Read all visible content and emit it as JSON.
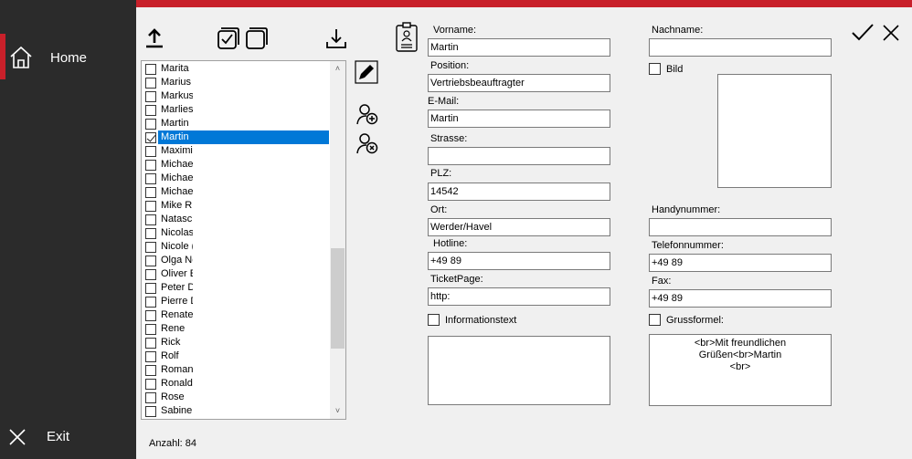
{
  "sidebar": {
    "home_label": "Home",
    "exit_label": "Exit"
  },
  "toolbar_icons": [
    "upload-icon",
    "check-all-icon",
    "uncheck-all-icon",
    "download-icon",
    "contact-card-icon",
    "edit-icon",
    "add-user-icon",
    "remove-user-icon",
    "confirm-icon",
    "close-icon"
  ],
  "list": {
    "items": [
      {
        "label": "Marita",
        "checked": false,
        "selected": false
      },
      {
        "label": "Marius",
        "checked": false,
        "selected": false
      },
      {
        "label": "Markus",
        "checked": false,
        "selected": false
      },
      {
        "label": "Marlies",
        "checked": false,
        "selected": false
      },
      {
        "label": "Martin",
        "checked": false,
        "selected": false
      },
      {
        "label": "Martin",
        "checked": true,
        "selected": true
      },
      {
        "label": "Maximil",
        "checked": false,
        "selected": false
      },
      {
        "label": "Michae",
        "checked": false,
        "selected": false
      },
      {
        "label": "Michae",
        "checked": false,
        "selected": false
      },
      {
        "label": "Michae",
        "checked": false,
        "selected": false
      },
      {
        "label": "Mike R",
        "checked": false,
        "selected": false
      },
      {
        "label": "Natasc",
        "checked": false,
        "selected": false
      },
      {
        "label": "Nicolas",
        "checked": false,
        "selected": false
      },
      {
        "label": "Nicole (",
        "checked": false,
        "selected": false
      },
      {
        "label": "Olga Ne",
        "checked": false,
        "selected": false
      },
      {
        "label": "Oliver E",
        "checked": false,
        "selected": false
      },
      {
        "label": "Peter D",
        "checked": false,
        "selected": false
      },
      {
        "label": "Pierre D",
        "checked": false,
        "selected": false
      },
      {
        "label": "Renate",
        "checked": false,
        "selected": false
      },
      {
        "label": "Rene",
        "checked": false,
        "selected": false
      },
      {
        "label": "Rick",
        "checked": false,
        "selected": false
      },
      {
        "label": "Rolf",
        "checked": false,
        "selected": false
      },
      {
        "label": "Roman",
        "checked": false,
        "selected": false
      },
      {
        "label": "Ronald",
        "checked": false,
        "selected": false
      },
      {
        "label": "Rose",
        "checked": false,
        "selected": false
      },
      {
        "label": "Sabine",
        "checked": false,
        "selected": false
      }
    ],
    "scroll_up": "˄",
    "scroll_down": "˅",
    "count_label": "Anzahl: 84"
  },
  "form": {
    "vorname_label": "Vorname:",
    "vorname_value": "Martin",
    "position_label": "Position:",
    "position_value": "Vertriebsbeauftragter",
    "email_label": "E-Mail:",
    "email_value": "Martin",
    "strasse_label": "Strasse:",
    "strasse_value": "",
    "plz_label": "PLZ:",
    "plz_value": "14542",
    "ort_label": "Ort:",
    "ort_value": "Werder/Havel",
    "hotline_label": "Hotline:",
    "hotline_value": "+49 89",
    "ticketpage_label": "TicketPage:",
    "ticketpage_value": "http:",
    "informationstext_label": "Informationstext",
    "informationstext_value": "",
    "nachname_label": "Nachname:",
    "nachname_value": "",
    "bild_label": "Bild",
    "handynummer_label": "Handynummer:",
    "handynummer_value": "",
    "telefonnummer_label": "Telefonnummer:",
    "telefonnummer_value": "+49 89",
    "fax_label": "Fax:",
    "fax_value": "+49 89",
    "grussformel_label": "Grussformel:",
    "grussformel_line1": "<br>Mit freundlichen Grüßen<br>Martin",
    "grussformel_line2": "<br>"
  },
  "colors": {
    "accent": "#c8202a",
    "sidebar": "#2b2b2b",
    "selection": "#0078d7"
  }
}
